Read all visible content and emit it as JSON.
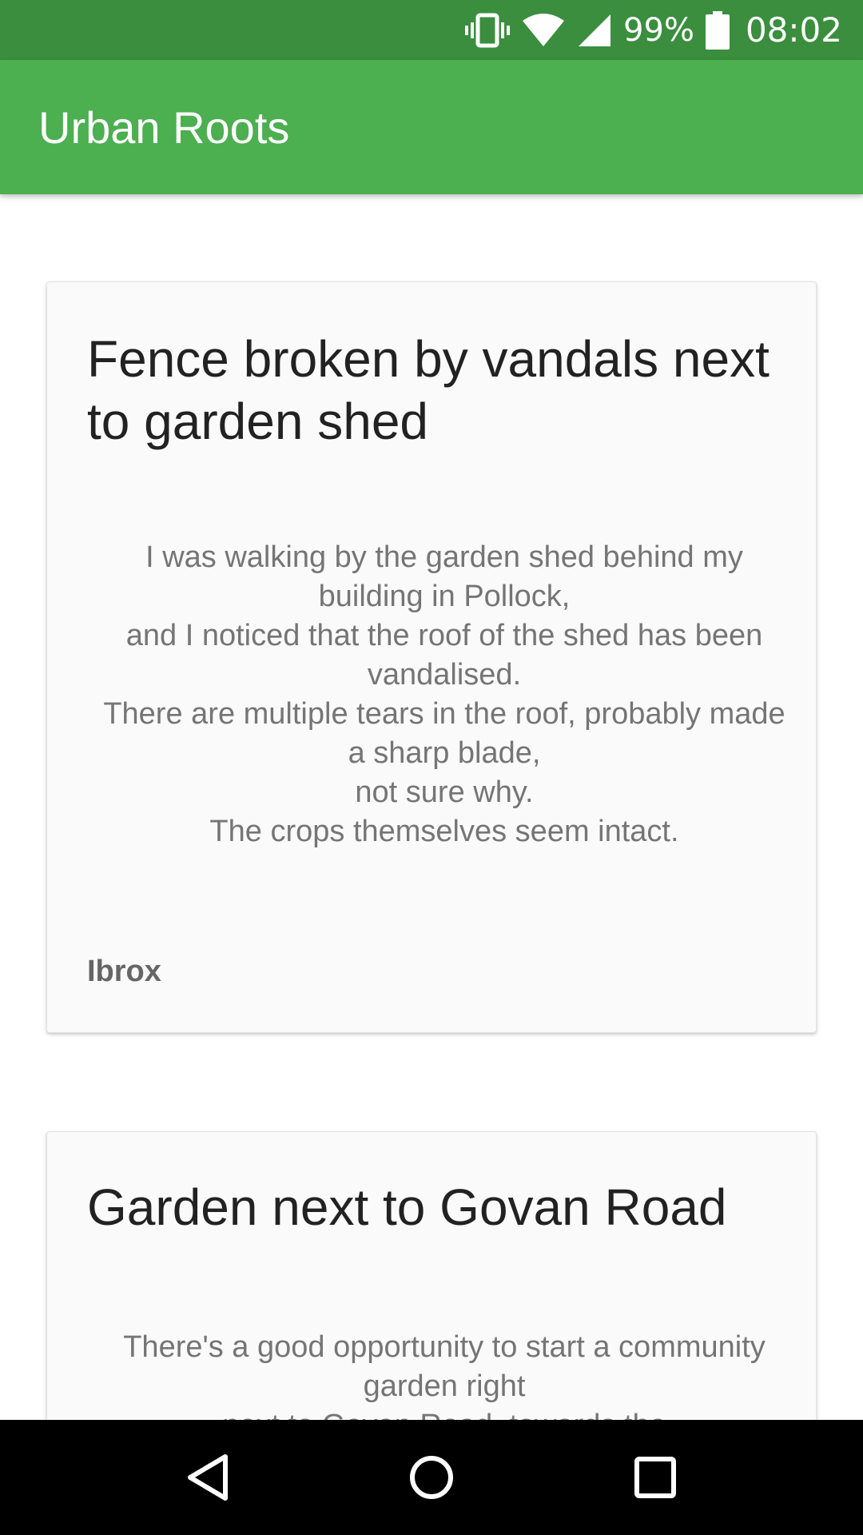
{
  "status_bar": {
    "battery_percent": "99%",
    "time": "08:02",
    "icons": [
      "vibrate-icon",
      "wifi-icon",
      "cell-signal-icon",
      "battery-icon"
    ]
  },
  "app_bar": {
    "title": "Urban Roots",
    "color": "#4caf50"
  },
  "reports": [
    {
      "title": "Fence broken by vandals next to garden shed",
      "body_lines": [
        "I was walking by the garden shed behind my building in Pollock,",
        "and I noticed that the roof of the shed has been vandalised.",
        "There are multiple tears in the roof, probably made a sharp blade,",
        "not sure why.",
        "The crops themselves seem intact."
      ],
      "location": "Ibrox"
    },
    {
      "title": "Garden next to Govan Road",
      "body_lines": [
        "There's a good opportunity to start a community garden right",
        "next to Govan Road, towards the"
      ]
    }
  ],
  "nav_bar": {
    "icons": [
      "back-icon",
      "home-icon",
      "recents-icon"
    ]
  }
}
